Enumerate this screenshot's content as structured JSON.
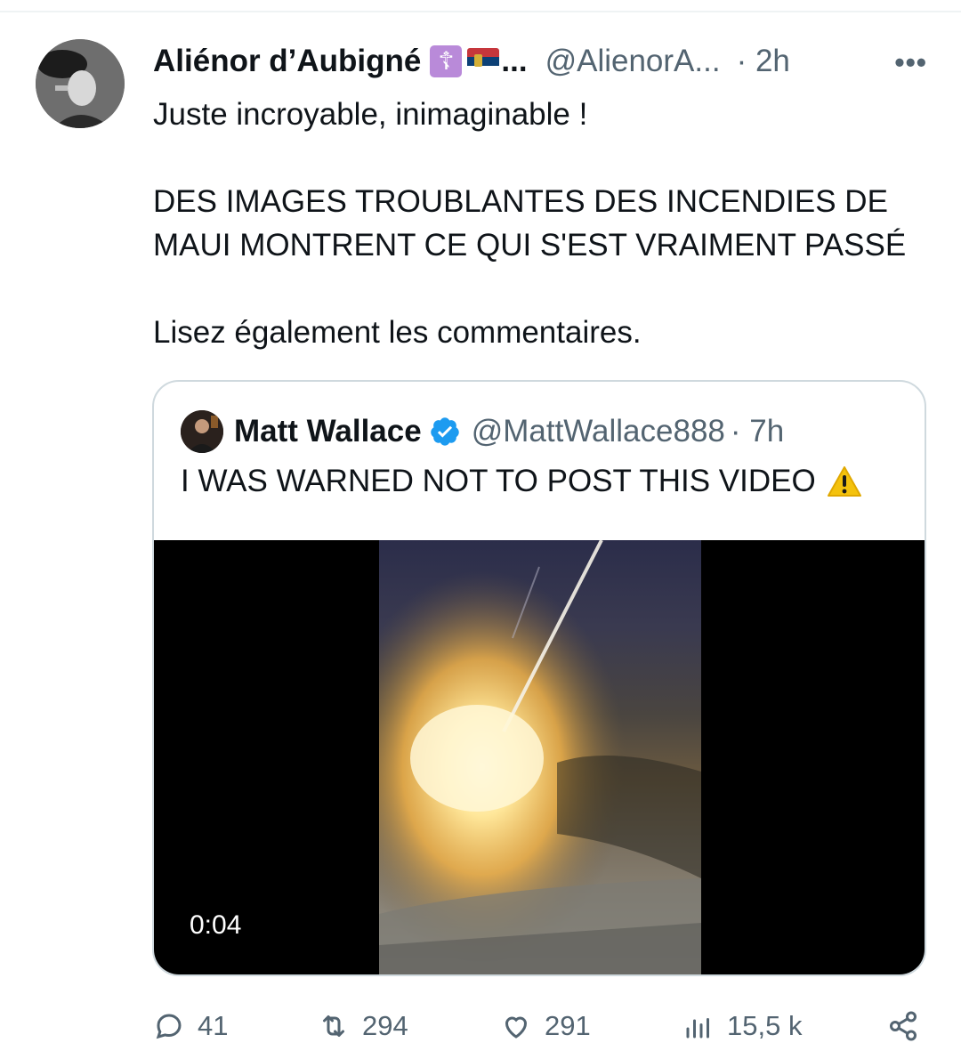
{
  "tweet": {
    "author": {
      "display_name": "Aliénor d’Aubigné",
      "badge_cross": "☦",
      "name_ellipsis": "...",
      "handle": "@AlienorA...",
      "time": "· 2h"
    },
    "more_label": "•••",
    "text_lines": [
      "Juste incroyable, inimaginable !",
      "DES IMAGES TROUBLANTES DES INCENDIES DE",
      "MAUI MONTRENT CE QUI S'EST VRAIMENT PASSÉ",
      "Lisez également les commentaires."
    ],
    "quoted": {
      "display_name": "Matt Wallace",
      "handle": "@MattWallace888",
      "time": "· 7h",
      "text": "I WAS WARNED NOT TO POST THIS VIDEO",
      "video_duration": "0:04"
    },
    "actions": {
      "replies": "41",
      "retweets": "294",
      "likes": "291",
      "views": "15,5 k"
    }
  },
  "colors": {
    "text": "#0f1419",
    "secondary": "#536471",
    "border": "#cfd9de",
    "verified": "#1d9bf0"
  },
  "icons": [
    "reply-icon",
    "retweet-icon",
    "like-icon",
    "views-icon",
    "share-icon",
    "verified-icon",
    "warning-icon"
  ]
}
